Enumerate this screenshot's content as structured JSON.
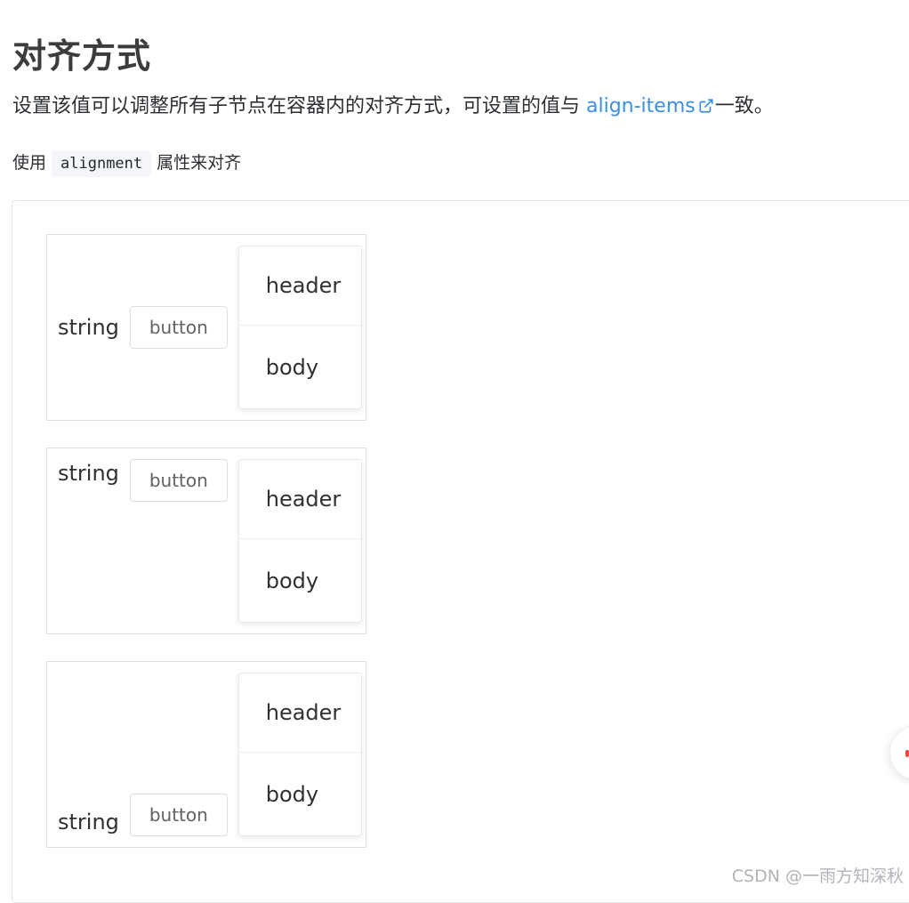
{
  "heading": "对齐方式",
  "description": {
    "before": "设置该值可以调整所有子节点在容器内的对齐方式，可设置的值与 ",
    "link": "align-items",
    "after": "一致。"
  },
  "usage": {
    "before": "使用",
    "code": "alignment",
    "after": "属性来对齐"
  },
  "rows": [
    {
      "alignment": "center",
      "text": "string",
      "button": "button",
      "card_header": "header",
      "card_body": "body"
    },
    {
      "alignment": "start",
      "text": "string",
      "button": "button",
      "card_header": "header",
      "card_body": "body"
    },
    {
      "alignment": "end",
      "text": "string",
      "button": "button",
      "card_header": "header",
      "card_body": "body"
    }
  ],
  "watermark": "CSDN @一雨方知深秋",
  "colors": {
    "link": "#3a8ee6",
    "border": "#dcdfe6"
  }
}
